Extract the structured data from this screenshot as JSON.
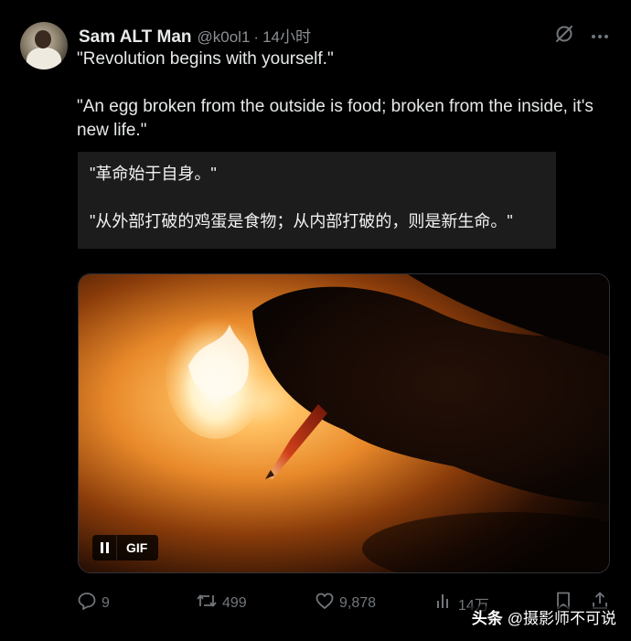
{
  "author": {
    "name": "Sam ALT Man",
    "handle": "@k0ol1",
    "separator": "·",
    "time": "14小时"
  },
  "tweet": {
    "line1": "\"Revolution begins with yourself.\"",
    "line2": "\"An egg broken from the outside is food; broken from the inside, it's new life.\""
  },
  "translation": {
    "line1": "\"革命始于自身。\"",
    "line2": "\"从外部打破的鸡蛋是食物；从内部打破的，则是新生命。\""
  },
  "media": {
    "type_label": "GIF",
    "state": "playing"
  },
  "actions": {
    "replies": "9",
    "reposts": "499",
    "likes": "9,878",
    "views": "14万"
  },
  "watermark": {
    "brand": "头条",
    "account": "@摄影师不可说"
  },
  "icons": {
    "top_right": [
      "grok-icon",
      "more-dots-icon"
    ],
    "actions": [
      "reply-icon",
      "repost-icon",
      "like-icon",
      "views-icon",
      "bookmark-icon",
      "share-icon"
    ]
  },
  "colors": {
    "background": "#000000",
    "text_primary": "#e7e9ea",
    "text_secondary": "#71767b",
    "translation_box": "#1c1c1c"
  }
}
